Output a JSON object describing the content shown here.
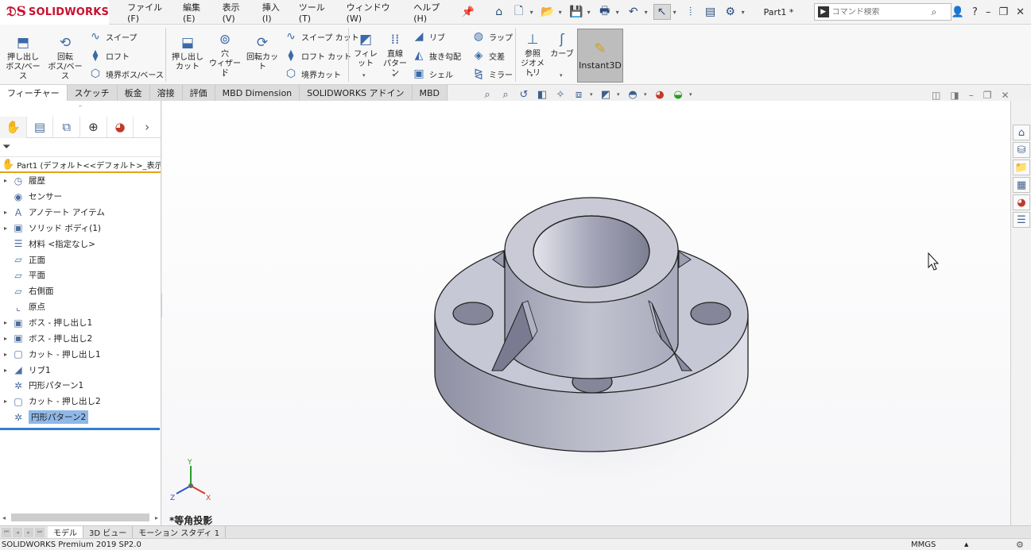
{
  "app": {
    "brand": "SOLIDWORKS",
    "document_title": "Part1 *"
  },
  "menu": [
    "ファイル(F)",
    "編集(E)",
    "表示(V)",
    "挿入(I)",
    "ツール(T)",
    "ウィンドウ(W)",
    "ヘルプ(H)"
  ],
  "search": {
    "placeholder": "コマンド検索"
  },
  "ribbon": {
    "extrude_boss": "押し出し\nボス/ベース",
    "revolve_boss": "回転\nボス/ベース",
    "sweep": "スイープ",
    "loft": "ロフト",
    "boundary_boss": "境界ボス/ベース",
    "extrude_cut": "押し出し\nカット",
    "hole_wizard": "穴\nウィザード",
    "revolve_cut": "回転カット",
    "swept_cut": "スイープ カット",
    "loft_cut": "ロフト カット",
    "boundary_cut": "境界カット",
    "fillet": "フィレット",
    "linear_pattern": "直線\nパターン",
    "rib": "リブ",
    "draft": "抜き勾配",
    "shell": "シェル",
    "wrap": "ラップ",
    "intersect": "交差",
    "mirror": "ミラー",
    "ref_geometry": "参照\nジオメトリ",
    "curves": "カーブ",
    "instant3d": "Instant3D"
  },
  "cm_tabs": [
    "フィーチャー",
    "スケッチ",
    "板金",
    "溶接",
    "評価",
    "MBD Dimension",
    "SOLIDWORKS アドイン",
    "MBD"
  ],
  "feature_tree": {
    "root": "Part1 (デフォルト<<デフォルト>_表示状態",
    "items": [
      {
        "label": "履歴",
        "icon": "history-icon",
        "glyph": "◷",
        "expandable": true
      },
      {
        "label": "センサー",
        "icon": "sensor-icon",
        "glyph": "◉",
        "expandable": false
      },
      {
        "label": "アノテート アイテム",
        "icon": "annotations-icon",
        "glyph": "A",
        "expandable": true
      },
      {
        "label": "ソリッド ボディ(1)",
        "icon": "solid-body-icon",
        "glyph": "▣",
        "expandable": true
      },
      {
        "label": "材料 <指定なし>",
        "icon": "material-icon",
        "glyph": "☰",
        "expandable": false
      },
      {
        "label": "正面",
        "icon": "plane-icon",
        "glyph": "▱",
        "expandable": false
      },
      {
        "label": "平面",
        "icon": "plane-icon",
        "glyph": "▱",
        "expandable": false
      },
      {
        "label": "右側面",
        "icon": "plane-icon",
        "glyph": "▱",
        "expandable": false
      },
      {
        "label": "原点",
        "icon": "origin-icon",
        "glyph": "⌞",
        "expandable": false
      },
      {
        "label": "ボス - 押し出し1",
        "icon": "boss-extrude-icon",
        "glyph": "▣",
        "expandable": true
      },
      {
        "label": "ボス - 押し出し2",
        "icon": "boss-extrude-icon",
        "glyph": "▣",
        "expandable": true
      },
      {
        "label": "カット - 押し出し1",
        "icon": "cut-extrude-icon",
        "glyph": "▢",
        "expandable": true
      },
      {
        "label": "リブ1",
        "icon": "rib-icon",
        "glyph": "◢",
        "expandable": true
      },
      {
        "label": "円形パターン1",
        "icon": "circular-pattern-icon",
        "glyph": "✲",
        "expandable": false
      },
      {
        "label": "カット - 押し出し2",
        "icon": "cut-extrude-icon",
        "glyph": "▢",
        "expandable": true
      },
      {
        "label": "円形パターン2",
        "icon": "circular-pattern-icon",
        "glyph": "✲",
        "expandable": false,
        "selected": true
      }
    ]
  },
  "view": {
    "orientation_label": "*等角投影",
    "axis_x": "X",
    "axis_y": "Y",
    "axis_z": "Z"
  },
  "bottom_tabs": [
    "モデル",
    "3D ビュー",
    "モーション スタディ 1"
  ],
  "status": {
    "version": "SOLIDWORKS Premium 2019 SP2.0",
    "units": "MMGS"
  },
  "colors": {
    "brand_red": "#c8102e",
    "selection_blue": "#2f7fd1",
    "instant3d_active": "#bdbdbd",
    "part_gray": "#b8b9c8"
  }
}
